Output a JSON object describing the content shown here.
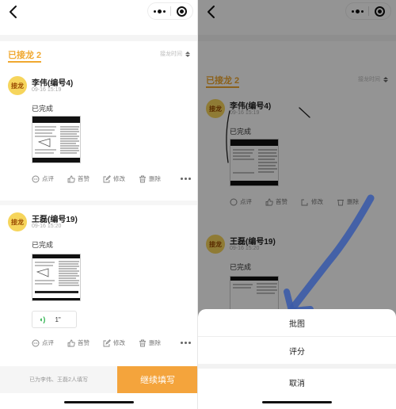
{
  "header": {
    "back_icon": "chevron-left-icon",
    "more_icon": "more-dots-icon",
    "close_icon": "target-icon"
  },
  "section": {
    "title": "已接龙 2",
    "sort_label": "接龙时间"
  },
  "entries": [
    {
      "avatar": "接龙",
      "name": "李伟(编号4)",
      "time": "09-16 15:19",
      "status": "已完成",
      "voice": null
    },
    {
      "avatar": "接龙",
      "name": "王磊(编号19)",
      "time": "09-16 15:20",
      "status": "已完成",
      "voice": {
        "length": "1\""
      }
    }
  ],
  "actions": {
    "comment": "点评",
    "like": "首赞",
    "edit": "修改",
    "delete": "删除"
  },
  "bottom": {
    "filled_note": "已为李伟、王磊2人填写",
    "continue_label": "继续填写"
  },
  "sheet": {
    "options": [
      "批图",
      "评分"
    ],
    "cancel": "取消"
  },
  "colors": {
    "accent": "#f0a830",
    "button": "#f4a43c",
    "avatar_bg": "#f6d55c",
    "voice_green": "#2bb24c",
    "annotation_ink": "#3b5ba9"
  }
}
